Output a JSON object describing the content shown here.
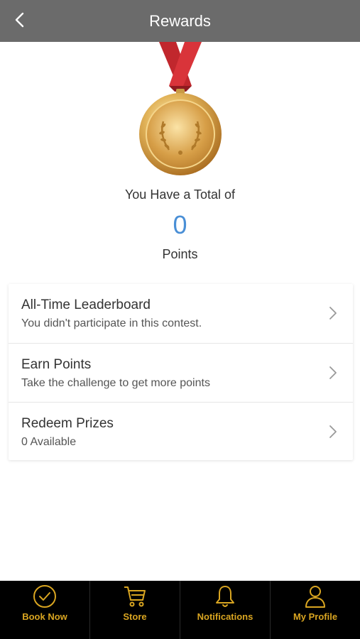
{
  "header": {
    "title": "Rewards",
    "back_icon": "chevron-left-icon"
  },
  "summary": {
    "total_label": "You Have a Total of",
    "points_value": "0",
    "points_label": "Points",
    "medal_icon": "gold-medal-icon"
  },
  "list": {
    "items": [
      {
        "title": "All-Time Leaderboard",
        "subtitle": "You didn't participate in this contest."
      },
      {
        "title": "Earn Points",
        "subtitle": "Take the challenge to get more points"
      },
      {
        "title": "Redeem Prizes",
        "subtitle": "0 Available"
      }
    ]
  },
  "bottom_nav": {
    "items": [
      {
        "label": "Book Now",
        "icon": "check-circle-icon"
      },
      {
        "label": "Store",
        "icon": "cart-icon"
      },
      {
        "label": "Notifications",
        "icon": "bell-icon"
      },
      {
        "label": "My Profile",
        "icon": "user-icon"
      }
    ]
  },
  "colors": {
    "header_bg": "#6b6b6b",
    "points_blue": "#4a8fd6",
    "nav_bg": "#000000",
    "nav_gold": "#d9a521"
  }
}
